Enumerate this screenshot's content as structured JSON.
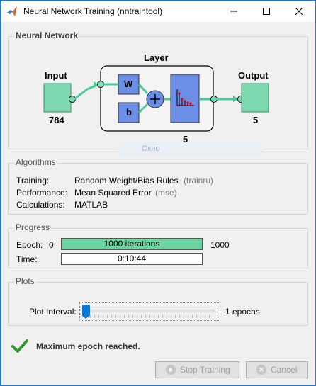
{
  "window": {
    "title": "Neural Network Training (nntraintool)"
  },
  "network": {
    "panel_title": "Neural Network",
    "input_label": "Input",
    "input_size": "784",
    "layer_label": "Layer",
    "weight_label": "W",
    "bias_label": "b",
    "layer_size": "5",
    "output_label": "Output",
    "output_size": "5",
    "overlay_text": "Окно"
  },
  "algorithms": {
    "panel_title": "Algorithms",
    "rows": [
      {
        "label": "Training:",
        "value": "Random Weight/Bias Rules",
        "code": "(trainru)"
      },
      {
        "label": "Performance:",
        "value": "Mean Squared Error",
        "code": "(mse)"
      },
      {
        "label": "Calculations:",
        "value": "MATLAB",
        "code": ""
      }
    ]
  },
  "progress": {
    "panel_title": "Progress",
    "epoch_label": "Epoch:",
    "epoch_start": "0",
    "epoch_bar_text": "1000 iterations",
    "epoch_end": "1000",
    "epoch_fraction": 1.0,
    "time_label": "Time:",
    "time_value": "0:10:44"
  },
  "plots": {
    "panel_title": "Plots",
    "interval_label": "Plot Interval:",
    "interval_value": "1 epochs",
    "slider_fraction": 0
  },
  "status": {
    "message": "Maximum epoch reached."
  },
  "buttons": {
    "stop": "Stop Training",
    "cancel": "Cancel"
  },
  "colors": {
    "node_green": "#7fd9b0",
    "layer_blue": "#6c8ee6",
    "progress_fill": "#6cd3a1",
    "slider_blue": "#0b7ad6"
  }
}
